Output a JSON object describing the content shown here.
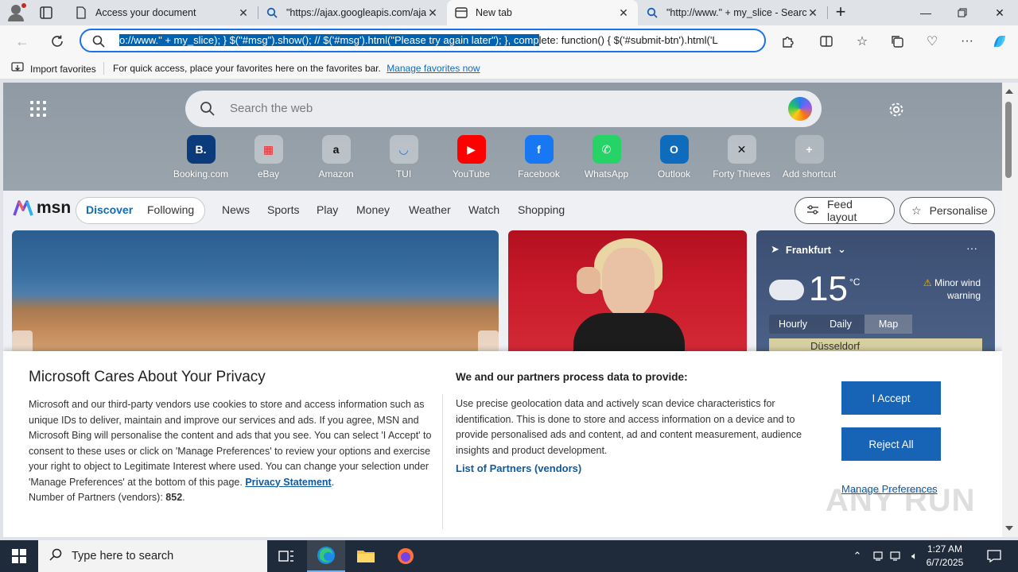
{
  "browser": {
    "tabs": [
      {
        "title": "Access your document",
        "icon": "document-icon",
        "active": false
      },
      {
        "title": "\"https://ajax.googleapis.com/aja",
        "icon": "search-icon",
        "active": false
      },
      {
        "title": "New tab",
        "icon": "newtab-icon",
        "active": true
      },
      {
        "title": "\"http://www.\" + my_slice - Searc",
        "icon": "search-icon",
        "active": false
      }
    ],
    "address": {
      "selected_text": "o://www.\" + my_slice); } $(\"#msg\").show(); // $('#msg').html(\"Please try again later\"); }, comp",
      "rest_text": "lete: function() { $('#submit-btn').html('L"
    }
  },
  "favbar": {
    "import_label": "Import favorites",
    "message": "For quick access, place your favorites here on the favorites bar.",
    "manage_link": "Manage favorites now"
  },
  "newtab": {
    "search_placeholder": "Search the web",
    "shortcuts": [
      {
        "label": "Booking.com",
        "glyph": "B.",
        "color": "#ffffff",
        "bg": "#0c3b7c"
      },
      {
        "label": "eBay",
        "glyph": "▦",
        "color": "#e53238",
        "bg": "rgba(255,255,255,0.35)"
      },
      {
        "label": "Amazon",
        "glyph": "a",
        "color": "#111111",
        "bg": "rgba(255,255,255,0.35)"
      },
      {
        "label": "TUI",
        "glyph": "◡",
        "color": "#1a77d2",
        "bg": "rgba(255,255,255,0.35)"
      },
      {
        "label": "YouTube",
        "glyph": "▶",
        "color": "#ffffff",
        "bg": "#ff0000"
      },
      {
        "label": "Facebook",
        "glyph": "f",
        "color": "#ffffff",
        "bg": "#1877f2"
      },
      {
        "label": "WhatsApp",
        "glyph": "✆",
        "color": "#ffffff",
        "bg": "#25d366"
      },
      {
        "label": "Outlook",
        "glyph": "O",
        "color": "#ffffff",
        "bg": "#0f6cbd"
      },
      {
        "label": "Forty Thieves",
        "glyph": "✕",
        "color": "#111111",
        "bg": "rgba(255,255,255,0.35)"
      },
      {
        "label": "Add shortcut",
        "glyph": "+",
        "color": "#ffffff",
        "bg": "rgba(255,255,255,0.25)"
      }
    ]
  },
  "feed": {
    "logo": "msn",
    "nav": [
      "Discover",
      "Following",
      "News",
      "Sports",
      "Play",
      "Money",
      "Weather",
      "Watch",
      "Shopping"
    ],
    "feed_layout": "Feed layout",
    "personalise": "Personalise",
    "weather": {
      "location": "Frankfurt",
      "temp": "15",
      "unit": "°C",
      "warning": "Minor wind warning",
      "tabs": [
        "Hourly",
        "Daily",
        "Map"
      ],
      "map_city": "Düsseldorf"
    }
  },
  "consent": {
    "title": "Microsoft Cares About Your Privacy",
    "body": "Microsoft and our third-party vendors use cookies to store and access information such as unique IDs to deliver, maintain and improve our services and ads. If you agree, MSN and Microsoft Bing will personalise the content and ads that you see. You can select 'I Accept' to consent to these uses or click on 'Manage Preferences' to review your options and exercise your right to object to Legitimate Interest where used.  You can change your selection under 'Manage Preferences' at the bottom of this page.",
    "privacy_link": "Privacy Statement",
    "partners_label": "Number of Partners (vendors):",
    "partners_count": "852",
    "purposes_title": "We and our partners process data to provide:",
    "purposes_text": "Use precise geolocation data and actively scan device characteristics for identification. This is done to store and access information on a device and to provide personalised ads and content, ad and content measurement, audience insights and product development.",
    "partners_link": "List of Partners (vendors)",
    "accept": "I Accept",
    "reject": "Reject All",
    "manage": "Manage Preferences",
    "watermark": "ANY RUN"
  },
  "taskbar": {
    "search_placeholder": "Type here to search",
    "time": "1:27 AM",
    "date": "6/7/2025"
  }
}
